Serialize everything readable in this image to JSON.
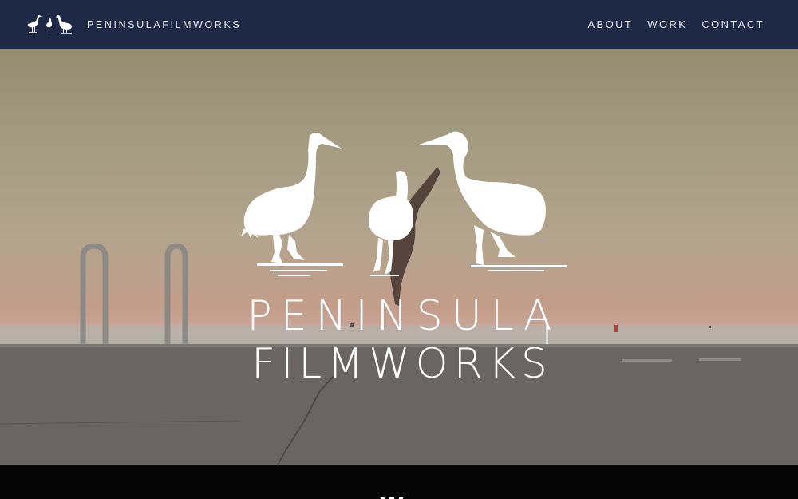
{
  "header": {
    "brand_name": "PENINSULAFILMWORKS",
    "logo_icon": "three-cranes-icon",
    "nav": [
      {
        "label": "ABOUT"
      },
      {
        "label": "WORK"
      },
      {
        "label": "CONTACT"
      }
    ]
  },
  "hero": {
    "title_line1": "PENINSULA",
    "title_line2": "FILMWORKS",
    "emblem_icon": "three-cranes-emblem-icon"
  },
  "section": {
    "partial_heading": "We"
  },
  "colors": {
    "header_bg": "#1e2945",
    "text": "#ffffff",
    "section_bg": "#050505"
  }
}
